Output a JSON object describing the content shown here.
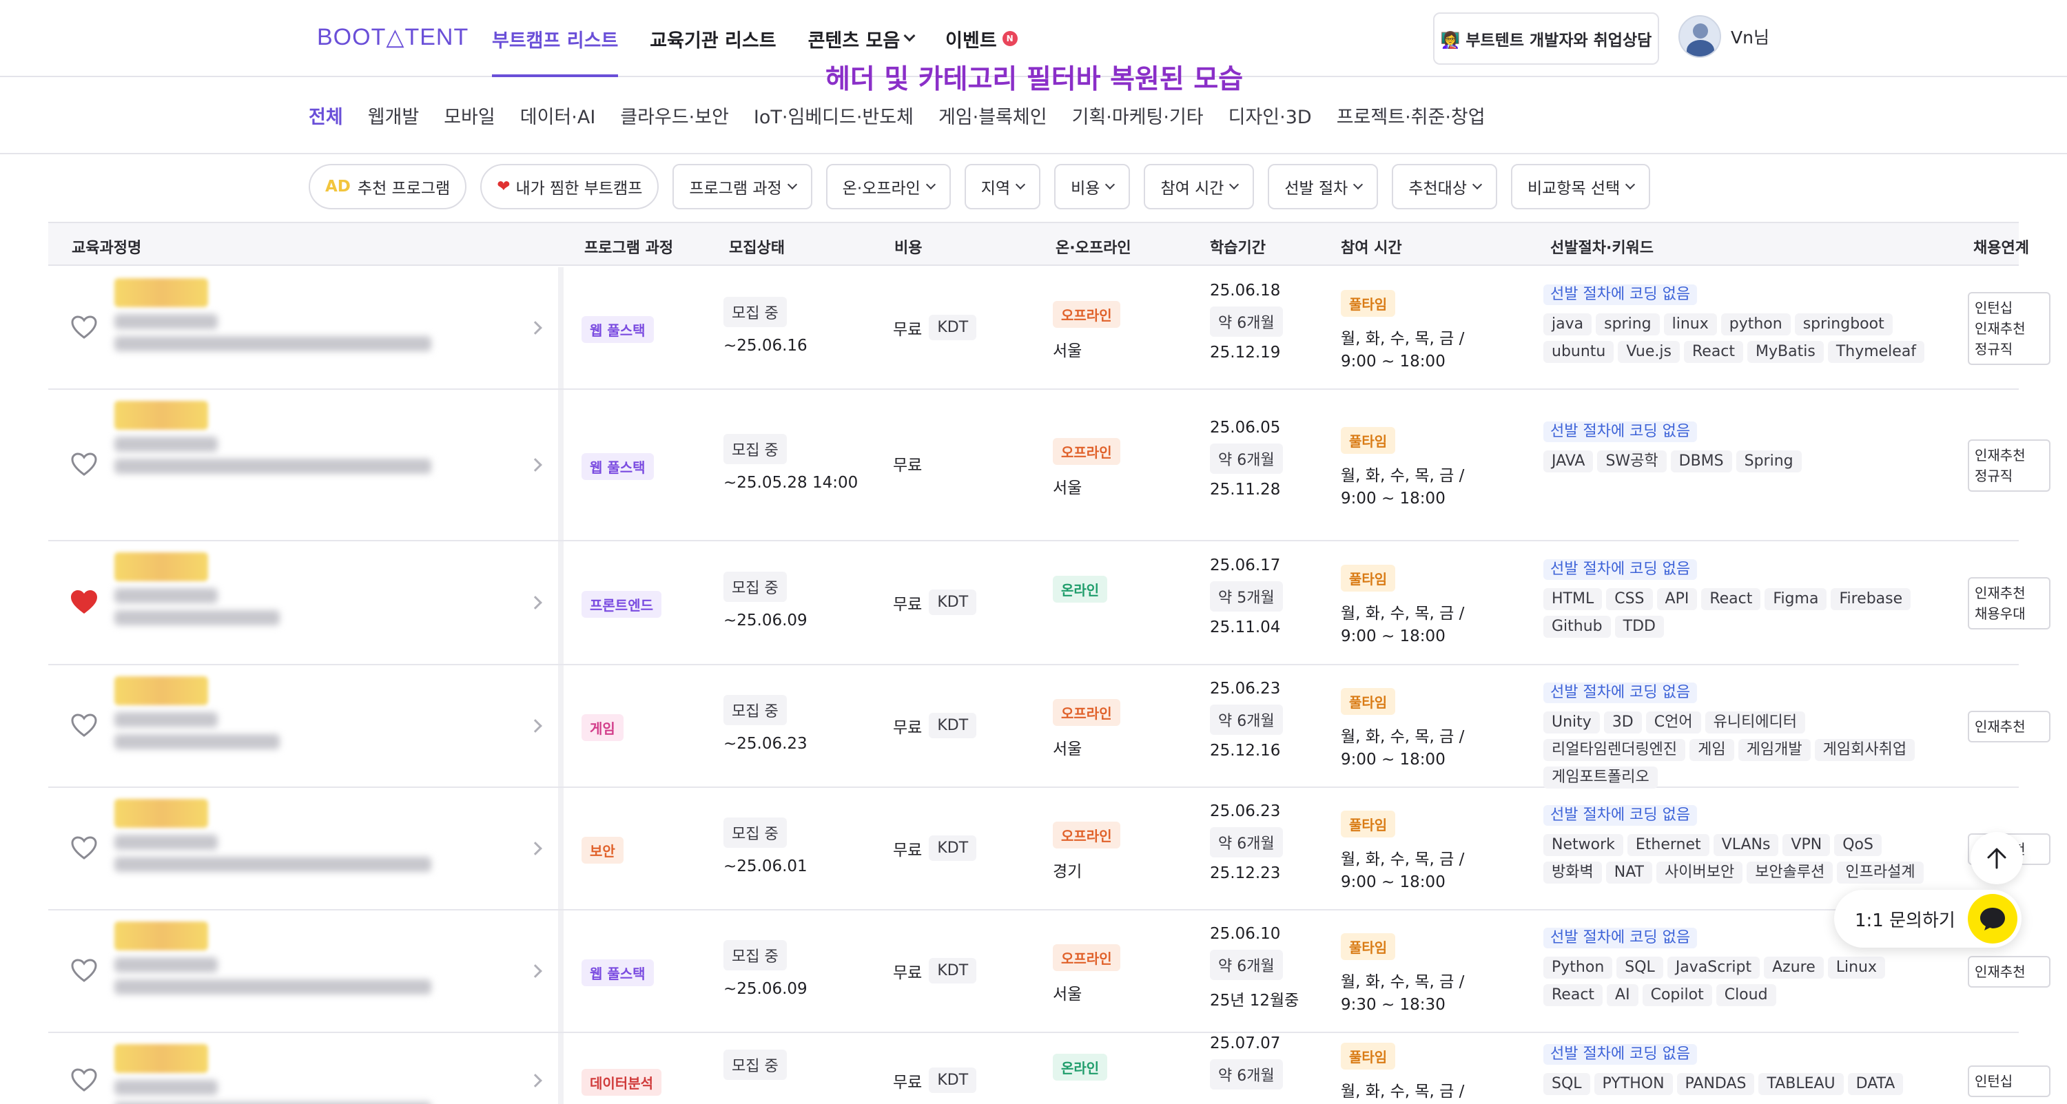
{
  "header": {
    "logo": "BOOT△TENT",
    "nav": [
      {
        "label": "부트캠프 리스트",
        "active": true
      },
      {
        "label": "교육기관 리스트"
      },
      {
        "label": "콘텐츠 모음"
      },
      {
        "label": "이벤트"
      }
    ],
    "event_badge": "N",
    "consult_label": "👩‍🏫 부트텐트 개발자와 취업상담",
    "username": "Vn님",
    "overlay_caption": "헤더 및 카테고리 필터바 복원된 모습"
  },
  "categories": [
    "전체",
    "웹개발",
    "모바일",
    "데이터·AI",
    "클라우드·보안",
    "IoT·임베디드·반도체",
    "게임·블록체인",
    "기획·마케팅·기타",
    "디자인·3D",
    "프로젝트·취준·창업"
  ],
  "filters": {
    "recommend": "추천 프로그램",
    "ad": "AD",
    "favorites": "내가 찜한 부트캠프",
    "dropdowns": [
      "프로그램 과정",
      "온·오프라인",
      "지역",
      "비용",
      "참여 시간",
      "선발 절차",
      "추천대상",
      "비교항목 선택"
    ]
  },
  "table": {
    "headers": [
      "교육과정명",
      "프로그램 과정",
      "모집상태",
      "비용",
      "온·오프라인",
      "학습기간",
      "참여 시간",
      "선발절차·키워드",
      "채용연계"
    ],
    "rows": [
      {
        "liked": false,
        "program": "웹 풀스택",
        "program_color": "purple",
        "status": "모집 중",
        "deadline": "~25.06.16",
        "cost": "무료",
        "kdt": "KDT",
        "mode": "오프라인",
        "mode_color": "orange",
        "region": "서울",
        "start": "25.06.18",
        "duration": "약 6개월",
        "end": "25.12.19",
        "time_type": "풀타임",
        "days": "월, 화, 수, 목, 금 /",
        "hours": "9:00 ~ 18:00",
        "coding": "선발 절차에 코딩 없음",
        "keywords": [
          "java",
          "spring",
          "linux",
          "python",
          "springboot",
          "ubuntu",
          "Vue.js",
          "React",
          "MyBatis",
          "Thymeleaf"
        ],
        "employment": [
          "인턴십",
          "인재추천",
          "정규직"
        ]
      },
      {
        "liked": false,
        "program": "웹 풀스택",
        "program_color": "purple",
        "status": "모집 중",
        "deadline": "~25.05.28 14:00",
        "cost": "무료",
        "kdt": "",
        "mode": "오프라인",
        "mode_color": "orange",
        "region": "서울",
        "start": "25.06.05",
        "duration": "약 6개월",
        "end": "25.11.28",
        "time_type": "풀타임",
        "days": "월, 화, 수, 목, 금 /",
        "hours": "9:00 ~ 18:00",
        "coding": "선발 절차에 코딩 없음",
        "keywords": [
          "JAVA",
          "SW공학",
          "DBMS",
          "Spring"
        ],
        "employment": [
          "인재추천",
          "정규직"
        ]
      },
      {
        "liked": true,
        "program": "프론트엔드",
        "program_color": "purple",
        "status": "모집 중",
        "deadline": "~25.06.09",
        "cost": "무료",
        "kdt": "KDT",
        "mode": "온라인",
        "mode_color": "teal",
        "region": "",
        "start": "25.06.17",
        "duration": "약 5개월",
        "end": "25.11.04",
        "time_type": "풀타임",
        "days": "월, 화, 수, 목, 금 /",
        "hours": "9:00 ~ 18:00",
        "coding": "선발 절차에 코딩 없음",
        "keywords": [
          "HTML",
          "CSS",
          "API",
          "React",
          "Figma",
          "Firebase",
          "Github",
          "TDD"
        ],
        "employment": [
          "인재추천",
          "채용우대"
        ]
      },
      {
        "liked": false,
        "program": "게임",
        "program_color": "pink",
        "status": "모집 중",
        "deadline": "~25.06.23",
        "cost": "무료",
        "kdt": "KDT",
        "mode": "오프라인",
        "mode_color": "orange",
        "region": "서울",
        "start": "25.06.23",
        "duration": "약 6개월",
        "end": "25.12.16",
        "time_type": "풀타임",
        "days": "월, 화, 수, 목, 금 /",
        "hours": "9:00 ~ 18:00",
        "coding": "선발 절차에 코딩 없음",
        "keywords": [
          "Unity",
          "3D",
          "C언어",
          "유니티에디터",
          "리얼타임렌더링엔진",
          "게임",
          "게임개발",
          "게임회사취업",
          "게임포트폴리오"
        ],
        "employment": [
          "인재추천"
        ]
      },
      {
        "liked": false,
        "program": "보안",
        "program_color": "orange",
        "status": "모집 중",
        "deadline": "~25.06.01",
        "cost": "무료",
        "kdt": "KDT",
        "mode": "오프라인",
        "mode_color": "orange",
        "region": "경기",
        "start": "25.06.23",
        "duration": "약 6개월",
        "end": "25.12.23",
        "time_type": "풀타임",
        "days": "월, 화, 수, 목, 금 /",
        "hours": "9:00 ~ 18:00",
        "coding": "선발 절차에 코딩 없음",
        "keywords": [
          "Network",
          "Ethernet",
          "VLANs",
          "VPN",
          "QoS",
          "방화벽",
          "NAT",
          "사이버보안",
          "보안솔루션",
          "인프라설계"
        ],
        "employment": [
          "인재추천"
        ]
      },
      {
        "liked": false,
        "program": "웹 풀스택",
        "program_color": "purple",
        "status": "모집 중",
        "deadline": "~25.06.09",
        "cost": "무료",
        "kdt": "KDT",
        "mode": "오프라인",
        "mode_color": "orange",
        "region": "서울",
        "start": "25.06.10",
        "duration": "약 6개월",
        "end": "25년 12월중",
        "time_type": "풀타임",
        "days": "월, 화, 수, 목, 금 /",
        "hours": "9:30 ~ 18:30",
        "coding": "선발 절차에 코딩 없음",
        "keywords": [
          "Python",
          "SQL",
          "JavaScript",
          "Azure",
          "Linux",
          "React",
          "AI",
          "Copilot",
          "Cloud"
        ],
        "employment": [
          "인재추천"
        ]
      },
      {
        "liked": false,
        "program": "데이터분석",
        "program_color": "red",
        "status": "모집 중",
        "deadline": "",
        "cost": "무료",
        "kdt": "KDT",
        "mode": "온라인",
        "mode_color": "teal",
        "region": "",
        "start": "25.07.07",
        "duration": "약 6개월",
        "end": "",
        "time_type": "풀타임",
        "days": "월, 화, 수, 목, 금 /",
        "hours": "",
        "coding": "선발 절차에 코딩 없음",
        "keywords": [
          "SQL",
          "PYTHON",
          "PANDAS",
          "TABLEAU",
          "DATA"
        ],
        "employment": [
          "인턴십"
        ]
      }
    ]
  },
  "floating": {
    "inquiry_label": "1:1 문의하기"
  },
  "colors": {
    "accent": "#6a4fd8",
    "caption": "#8a2fc8",
    "heart": "#e03131",
    "kakao": "#fee500"
  }
}
